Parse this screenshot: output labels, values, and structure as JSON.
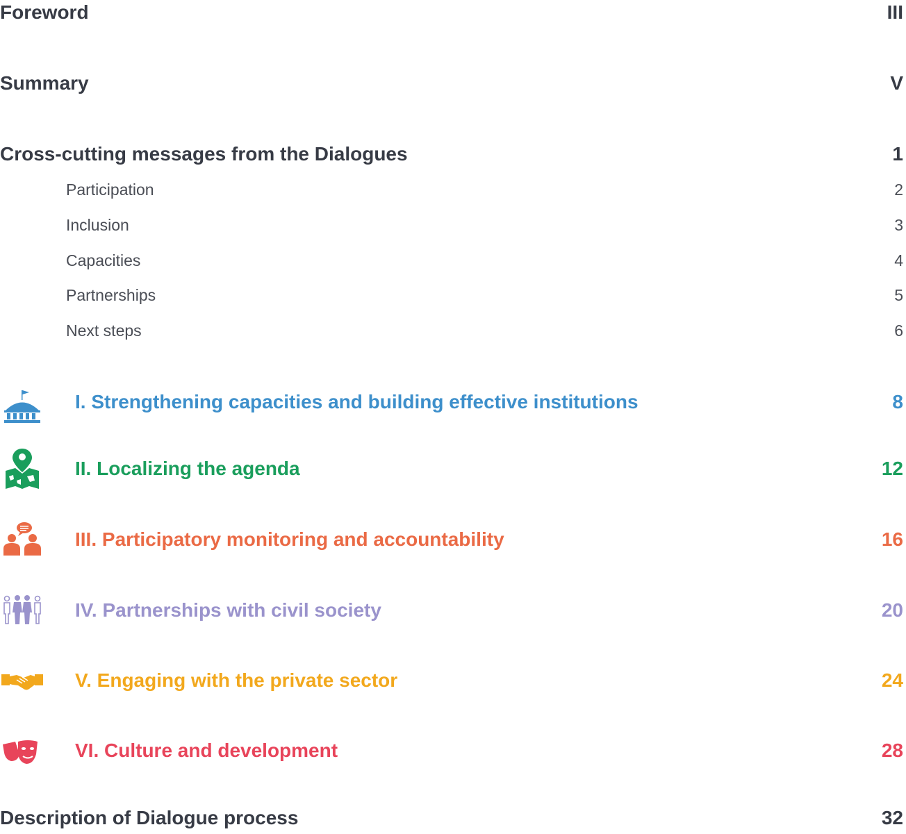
{
  "toc": {
    "foreword": {
      "title": "Foreword",
      "page": "III"
    },
    "summary": {
      "title": "Summary",
      "page": "V"
    },
    "cross_cutting": {
      "title": "Cross-cutting messages from the Dialogues",
      "page": "1",
      "subsections": [
        {
          "title": "Participation",
          "page": "2"
        },
        {
          "title": "Inclusion",
          "page": "3"
        },
        {
          "title": "Capacities",
          "page": "4"
        },
        {
          "title": "Partnerships",
          "page": "5"
        },
        {
          "title": "Next steps",
          "page": "6"
        }
      ]
    },
    "chapters": [
      {
        "title": "I.  Strengthening capacities and building effective institutions",
        "page": "8",
        "color": "#3d8fcb",
        "icon": "capitol-building-icon"
      },
      {
        "title": "II.  Localizing the agenda",
        "page": "12",
        "color": "#1a9e5c",
        "icon": "map-pin-icon"
      },
      {
        "title": "III.  Participatory monitoring and accountability",
        "page": "16",
        "color": "#ea6a45",
        "icon": "people-speech-icon"
      },
      {
        "title": "IV.  Partnerships with civil society",
        "page": "20",
        "color": "#9a93cc",
        "icon": "people-group-icon"
      },
      {
        "title": "V.  Engaging with the private sector",
        "page": "24",
        "color": "#f2a81d",
        "icon": "handshake-icon"
      },
      {
        "title": "VI.  Culture and development",
        "page": "28",
        "color": "#e8445a",
        "icon": "theatre-masks-icon"
      }
    ],
    "description": {
      "title": "Description of Dialogue process",
      "page": "32"
    }
  }
}
